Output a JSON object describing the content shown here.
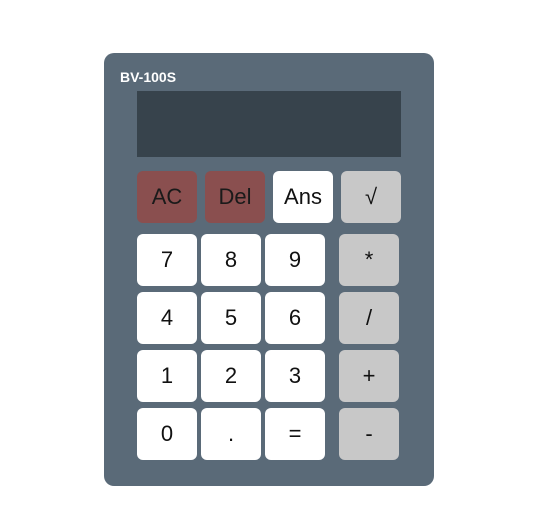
{
  "calculator": {
    "model": "BV-100S",
    "display_value": "",
    "keys": {
      "ac": "AC",
      "del": "Del",
      "ans": "Ans",
      "sqrt": "√",
      "seven": "7",
      "eight": "8",
      "nine": "9",
      "multiply": "*",
      "four": "4",
      "five": "5",
      "six": "6",
      "divide": "/",
      "one": "1",
      "two": "2",
      "three": "3",
      "plus": "+",
      "zero": "0",
      "dot": ".",
      "equals": "=",
      "minus": "-"
    }
  },
  "colors": {
    "body": "#5a6a78",
    "display": "#37434c",
    "clear_keys": "#8a4f4f",
    "operator_keys": "#c8c8c8",
    "number_keys": "#ffffff"
  }
}
